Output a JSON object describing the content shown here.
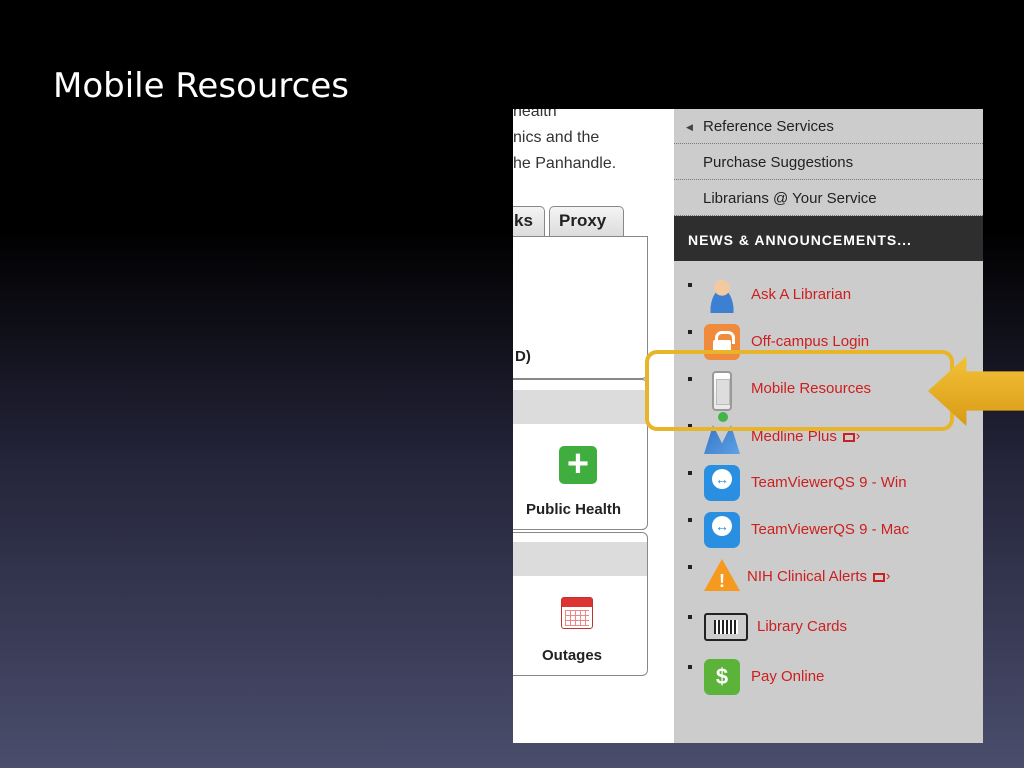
{
  "slide": {
    "title": "Mobile Resources"
  },
  "site": {
    "intro_lines": [
      "health",
      "nics and the",
      "he Panhandle."
    ],
    "tabs": [
      "ks",
      "Proxy"
    ],
    "box1_label": "D)",
    "box2_label": "Public Health",
    "box3_label": "Outages"
  },
  "sidebar": {
    "nav": [
      {
        "label": "Reference Services"
      },
      {
        "label": "Purchase Suggestions"
      },
      {
        "label": "Librarians @ Your Service"
      }
    ],
    "news_header": "NEWS & ANNOUNCEMENTS...",
    "resources": [
      {
        "label": "Ask A Librarian",
        "icon": "person-icon"
      },
      {
        "label": "Off-campus Login",
        "icon": "lock-icon"
      },
      {
        "label": "Mobile Resources",
        "icon": "phone-icon"
      },
      {
        "label": "Medline Plus",
        "icon": "medline-icon",
        "external": true
      },
      {
        "label": "TeamViewerQS 9 - Win",
        "icon": "teamviewer-icon"
      },
      {
        "label": "TeamViewerQS 9 - Mac",
        "icon": "teamviewer-icon"
      },
      {
        "label": "NIH Clinical Alerts",
        "icon": "warning-icon",
        "external": true
      },
      {
        "label": "Library Cards",
        "icon": "barcode-card-icon"
      },
      {
        "label": "Pay Online",
        "icon": "dollar-icon"
      }
    ]
  },
  "colors": {
    "link_red": "#cc1f1f",
    "callout_gold": "#e8b52a",
    "sidebar_gray": "#cccccc",
    "header_dark": "#2e2e2e"
  }
}
